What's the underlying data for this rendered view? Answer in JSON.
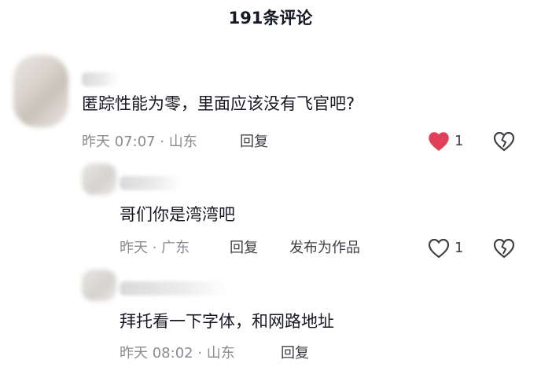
{
  "header": {
    "title": "191条评论"
  },
  "comments": [
    {
      "text": "匿踪性能为零，里面应该没有飞官吧?",
      "time": "昨天 07:07 · 山东",
      "reply_label": "回复",
      "likes": "1",
      "liked": true
    },
    {
      "text": "哥们你是湾湾吧",
      "time": "昨天 · 广东",
      "reply_label": "回复",
      "publish_label": "发布为作品",
      "likes": "1",
      "liked": false
    },
    {
      "text": "拜托看一下字体，和网路地址",
      "time": "昨天 08:02 · 山东",
      "reply_label": "回复"
    }
  ],
  "colors": {
    "like_active": "#e0405a",
    "text_primary": "#161823",
    "text_secondary": "#8a8b91"
  },
  "icons": {
    "like": "heart-icon",
    "dislike": "broken-heart-icon"
  }
}
